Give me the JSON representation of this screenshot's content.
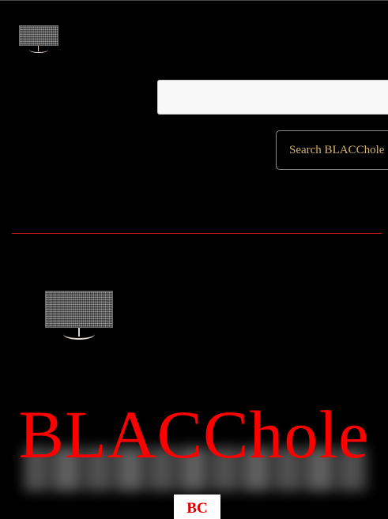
{
  "header": {
    "logo_icon": "tv-static-icon"
  },
  "search": {
    "value": "",
    "placeholder": "",
    "button_label": "Search BLACChole"
  },
  "hero": {
    "image_icon": "tv-static-icon",
    "brand_title": "BLACChole",
    "badge_text": "BC"
  },
  "colors": {
    "background": "#000000",
    "accent": "#ff0000",
    "divider": "#c4161c",
    "button_text": "#d4b36a"
  }
}
